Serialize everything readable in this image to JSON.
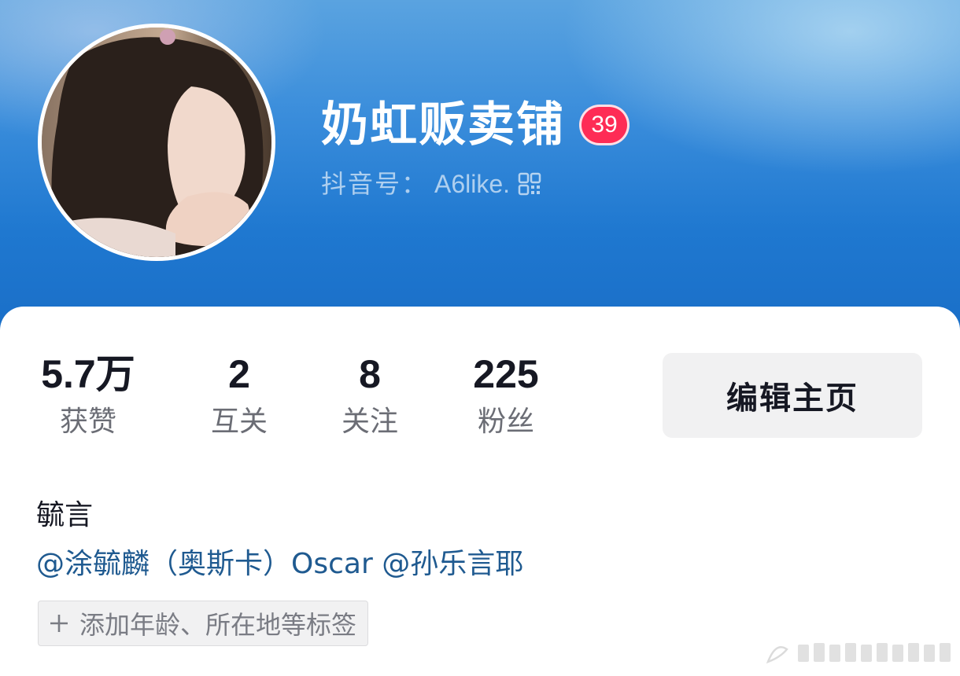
{
  "profile": {
    "nickname": "奶虹贩卖铺",
    "level_badge": "39",
    "douyin_id_label": "抖音号：",
    "douyin_id": "A6like.",
    "bio_name": "毓言",
    "bio_mentions": [
      "@涂毓麟（奥斯卡）Oscar",
      "@孙乐言耶"
    ],
    "add_tag_label": "添加年龄、所在地等标签"
  },
  "stats": [
    {
      "value": "5.7万",
      "label": "获赞"
    },
    {
      "value": "2",
      "label": "互关"
    },
    {
      "value": "8",
      "label": "关注"
    },
    {
      "value": "225",
      "label": "粉丝"
    }
  ],
  "actions": {
    "edit_profile": "编辑主页"
  },
  "colors": {
    "header_blue": "#1f78d0",
    "badge_red": "#fe2c55",
    "mention_blue": "#1f5a90",
    "text_primary": "#161823",
    "text_secondary": "#6b6d75",
    "chip_bg": "#f1f1f2"
  },
  "icons": {
    "qr": "qr-code-icon",
    "plus": "plus-icon"
  }
}
